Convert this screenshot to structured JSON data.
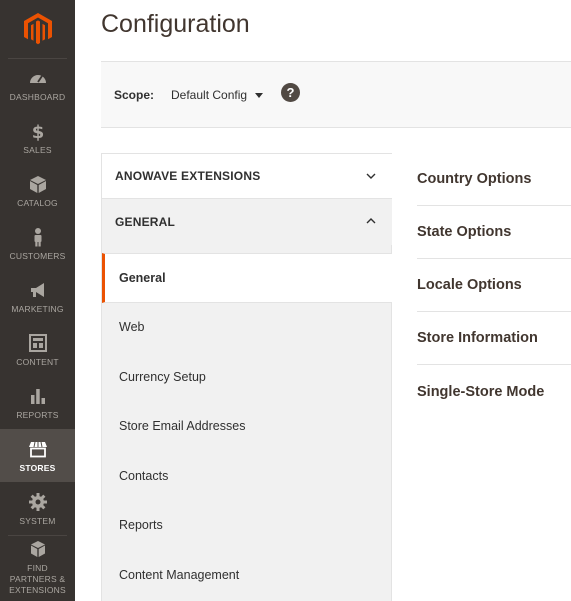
{
  "page": {
    "title": "Configuration"
  },
  "colors": {
    "sidebar_bg": "#373330",
    "active_bg": "#524d49",
    "brand_orange": "#eb5202"
  },
  "sidebar": {
    "logo": "magento-logo-icon",
    "items": [
      {
        "label": "DASHBOARD",
        "icon": "dashboard-gauge-icon"
      },
      {
        "label": "SALES",
        "icon": "dollar-icon"
      },
      {
        "label": "CATALOG",
        "icon": "box-icon"
      },
      {
        "label": "CUSTOMERS",
        "icon": "person-icon"
      },
      {
        "label": "MARKETING",
        "icon": "megaphone-icon"
      },
      {
        "label": "CONTENT",
        "icon": "layout-icon"
      },
      {
        "label": "REPORTS",
        "icon": "bar-chart-icon"
      },
      {
        "label": "STORES",
        "icon": "storefront-icon",
        "active": true
      },
      {
        "label": "SYSTEM",
        "icon": "gear-icon"
      },
      {
        "label": "FIND PARTNERS & EXTENSIONS",
        "icon": "cubes-icon"
      }
    ]
  },
  "scope": {
    "label": "Scope:",
    "value": "Default Config",
    "help": "?"
  },
  "tabs": {
    "sections": [
      {
        "label": "ANOWAVE EXTENSIONS",
        "expanded": false
      },
      {
        "label": "GENERAL",
        "expanded": true
      }
    ],
    "items": [
      {
        "label": "General",
        "active": true
      },
      {
        "label": "Web"
      },
      {
        "label": "Currency Setup"
      },
      {
        "label": "Store Email Addresses"
      },
      {
        "label": "Contacts"
      },
      {
        "label": "Reports"
      },
      {
        "label": "Content Management"
      }
    ]
  },
  "groups": [
    {
      "label": "Country Options"
    },
    {
      "label": "State Options"
    },
    {
      "label": "Locale Options"
    },
    {
      "label": "Store Information"
    },
    {
      "label": "Single-Store Mode"
    }
  ]
}
